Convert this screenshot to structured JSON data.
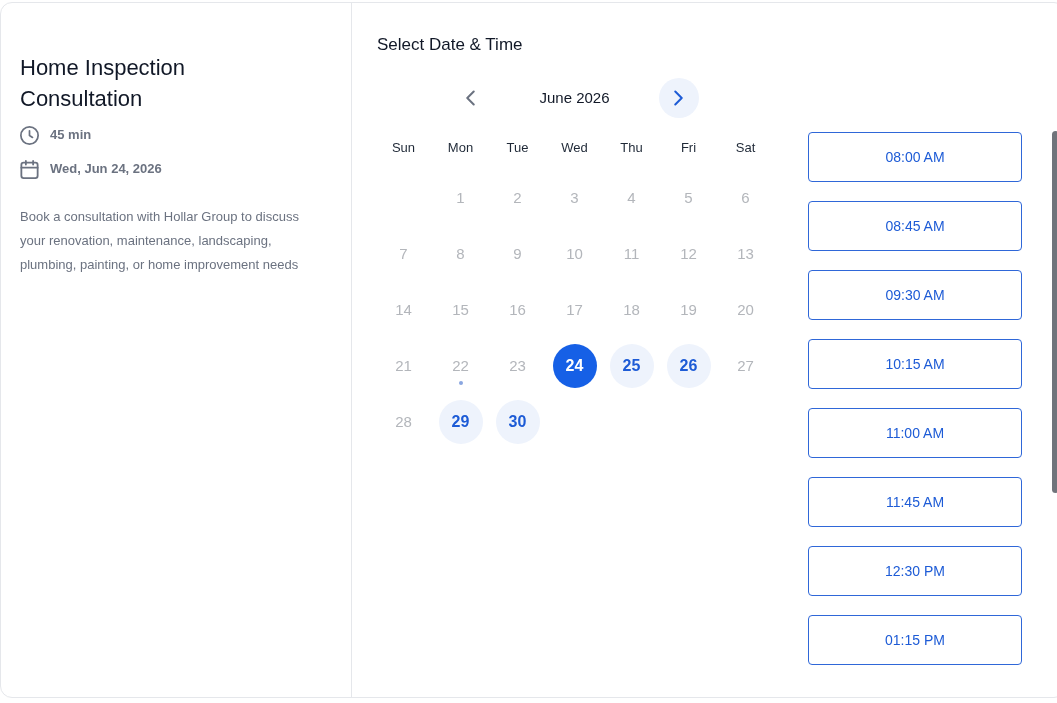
{
  "booking": {
    "title": "Home Inspection Consultation",
    "duration": "45 min",
    "date": "Wed, Jun 24, 2026",
    "description": "Book a consultation with Hollar Group to discuss your renovation, maintenance, landscaping, plumbing, painting, or home improvement needs"
  },
  "scheduler": {
    "heading": "Select Date & Time",
    "calendar": {
      "month": "June 2026",
      "previous": {
        "disabled": true
      },
      "next": {
        "disabled": false
      },
      "weekdays": [
        "Sun",
        "Mon",
        "Tue",
        "Wed",
        "Thu",
        "Fri",
        "Sat"
      ],
      "weeks": [
        [
          {
            "label": "1",
            "available": false,
            "selected": false,
            "today": false
          },
          {
            "label": "2",
            "available": false,
            "selected": false,
            "today": false
          },
          {
            "label": "3",
            "available": false,
            "selected": false,
            "today": false
          },
          {
            "label": "4",
            "available": false,
            "selected": false,
            "today": false
          },
          {
            "label": "5",
            "available": false,
            "selected": false,
            "today": false
          },
          {
            "label": "6",
            "available": false,
            "selected": false,
            "today": false
          }
        ],
        [
          {
            "label": "7",
            "available": false,
            "selected": false,
            "today": false
          },
          {
            "label": "8",
            "available": false,
            "selected": false,
            "today": false
          },
          {
            "label": "9",
            "available": false,
            "selected": false,
            "today": false
          },
          {
            "label": "10",
            "available": false,
            "selected": false,
            "today": false
          },
          {
            "label": "11",
            "available": false,
            "selected": false,
            "today": false
          },
          {
            "label": "12",
            "available": false,
            "selected": false,
            "today": false
          },
          {
            "label": "13",
            "available": false,
            "selected": false,
            "today": false
          }
        ],
        [
          {
            "label": "14",
            "available": false,
            "selected": false,
            "today": false
          },
          {
            "label": "15",
            "available": false,
            "selected": false,
            "today": false
          },
          {
            "label": "16",
            "available": false,
            "selected": false,
            "today": false
          },
          {
            "label": "17",
            "available": false,
            "selected": false,
            "today": false
          },
          {
            "label": "18",
            "available": false,
            "selected": false,
            "today": false
          },
          {
            "label": "19",
            "available": false,
            "selected": false,
            "today": false
          },
          {
            "label": "20",
            "available": false,
            "selected": false,
            "today": false
          }
        ],
        [
          {
            "label": "21",
            "available": false,
            "selected": false,
            "today": false
          },
          {
            "label": "22",
            "available": false,
            "selected": false,
            "today": true
          },
          {
            "label": "23",
            "available": false,
            "selected": false,
            "today": false
          },
          {
            "label": "24",
            "available": true,
            "selected": true,
            "today": false
          },
          {
            "label": "25",
            "available": true,
            "selected": false,
            "today": false
          },
          {
            "label": "26",
            "available": true,
            "selected": false,
            "today": false
          },
          {
            "label": "27",
            "available": false,
            "selected": false,
            "today": false
          }
        ],
        [
          {
            "label": "28",
            "available": false,
            "selected": false,
            "today": false
          },
          {
            "label": "29",
            "available": true,
            "selected": false,
            "today": false
          },
          {
            "label": "30",
            "available": true,
            "selected": false,
            "today": false
          }
        ]
      ]
    },
    "time_slots": [
      {
        "label": "08:00 AM",
        "selected": false
      },
      {
        "label": "08:45 AM",
        "selected": false
      },
      {
        "label": "09:30 AM",
        "selected": false
      },
      {
        "label": "10:15 AM",
        "selected": false
      },
      {
        "label": "11:00 AM",
        "selected": false
      },
      {
        "label": "11:45 AM",
        "selected": false
      },
      {
        "label": "12:30 PM",
        "selected": false
      },
      {
        "label": "01:15 PM",
        "selected": false
      }
    ]
  }
}
